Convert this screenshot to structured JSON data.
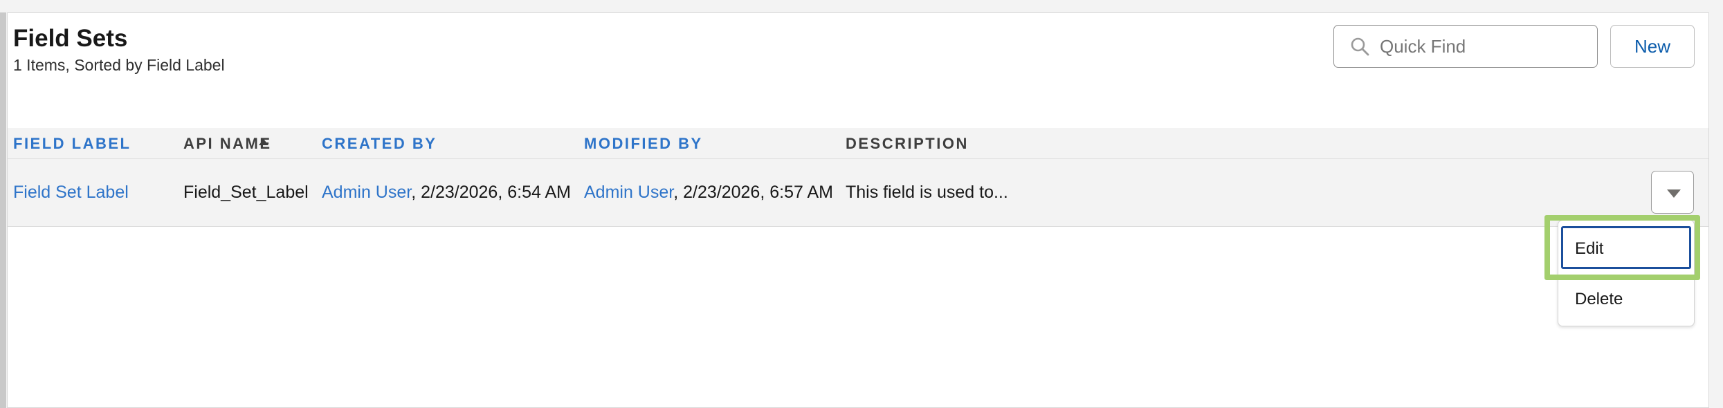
{
  "header": {
    "title": "Field Sets",
    "subtitle": "1 Items, Sorted by Field Label"
  },
  "search": {
    "placeholder": "Quick Find",
    "value": "",
    "icon": "search-icon"
  },
  "toolbar": {
    "new_label": "New"
  },
  "table": {
    "columns": [
      "Field Label",
      "API Name",
      "Created By",
      "Modified By",
      "Description"
    ],
    "sort": {
      "column": "Field Label",
      "direction": "ascending"
    },
    "rows": [
      {
        "field_label": "Field Set Label",
        "api_name": "Field_Set_Label",
        "created_by_user": "Admin User",
        "created_by_time": ", 2/23/2026, 6:54 AM",
        "modified_by_user": "Admin User",
        "modified_by_time": ", 2/23/2026, 6:57 AM",
        "description": "This field is used to..."
      }
    ]
  },
  "row_menu": {
    "items": [
      "Edit",
      "Delete"
    ],
    "focused": "Edit"
  },
  "colors": {
    "link": "#2e74c9",
    "highlight": "#a3cf6d",
    "focus_border": "#1b4f9c"
  }
}
